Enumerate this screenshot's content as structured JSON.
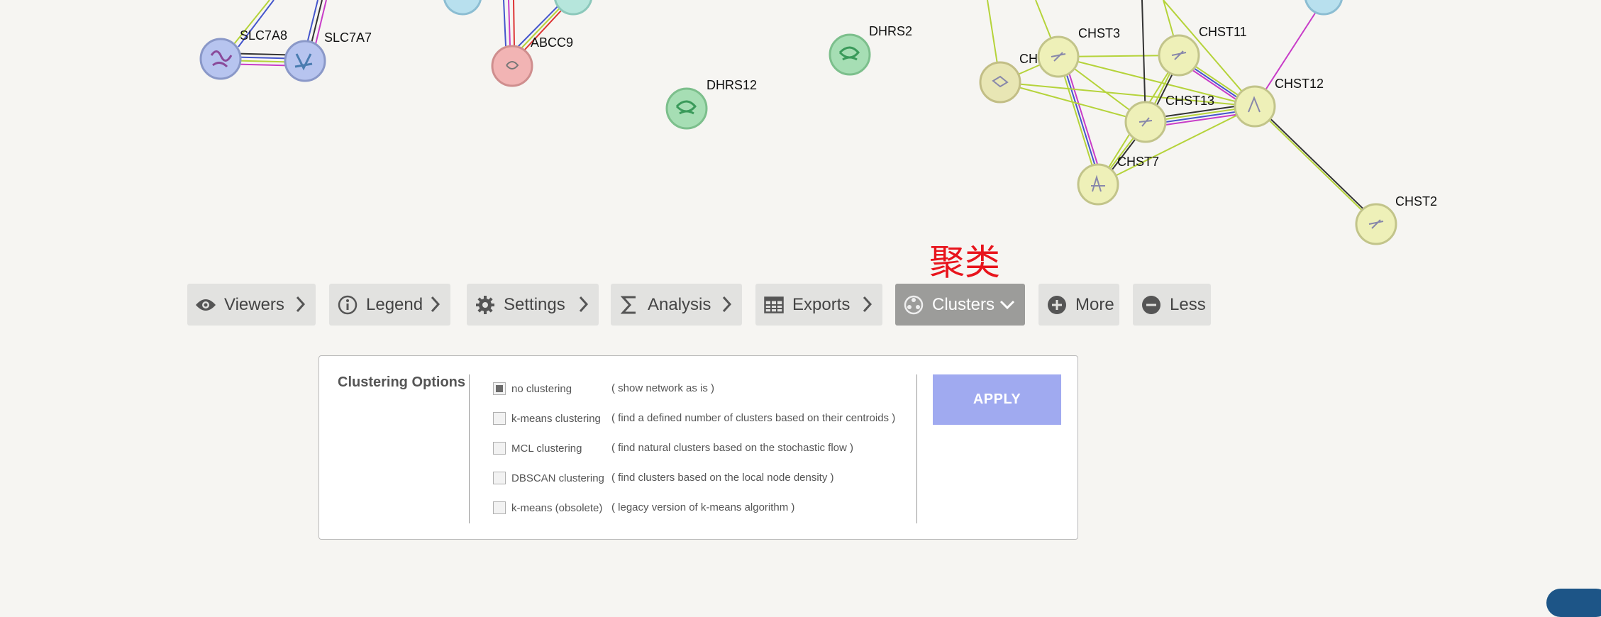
{
  "annotation": "聚类",
  "network": {
    "nodes": [
      {
        "label": "SLC7A8"
      },
      {
        "label": "SLC7A7"
      },
      {
        "label": "ABCC9"
      },
      {
        "label": "DHRS12"
      },
      {
        "label": "DHRS2"
      },
      {
        "label": "CH"
      },
      {
        "label": "CHST3"
      },
      {
        "label": "CHST11"
      },
      {
        "label": "CHST12"
      },
      {
        "label": "CHST13"
      },
      {
        "label": "CHST7"
      },
      {
        "label": "CHST2"
      }
    ],
    "colors": {
      "blue_node": "#b7c4ef",
      "red_node": "#f2b4b4",
      "green_node": "#a6deb4",
      "yellow_node": "#eef0b8",
      "edge_black": "#333333",
      "edge_yellowgreen": "#b5d33a",
      "edge_blue": "#4455cc",
      "edge_magenta": "#c83cc8"
    }
  },
  "toolbar": {
    "buttons": [
      {
        "label": "Viewers",
        "icon": "eye-icon"
      },
      {
        "label": "Legend",
        "icon": "info-icon"
      },
      {
        "label": "Settings",
        "icon": "gear-icon"
      },
      {
        "label": "Analysis",
        "icon": "sigma-icon"
      },
      {
        "label": "Exports",
        "icon": "table-icon"
      },
      {
        "label": "Clusters",
        "icon": "clusters-icon",
        "active": true
      },
      {
        "label": "More",
        "icon": "plus-circle-icon"
      },
      {
        "label": "Less",
        "icon": "minus-circle-icon"
      }
    ]
  },
  "clustering": {
    "title": "Clustering Options",
    "options": [
      {
        "label": "no clustering",
        "desc": "( show network as is )",
        "checked": true
      },
      {
        "label": "k-means clustering",
        "desc": "( find a defined number of clusters based on their centroids )",
        "checked": false
      },
      {
        "label": "MCL clustering",
        "desc": "( find natural clusters based on the stochastic flow )",
        "checked": false
      },
      {
        "label": "DBSCAN clustering",
        "desc": "( find clusters based on the local node density )",
        "checked": false
      },
      {
        "label": "k-means (obsolete)",
        "desc": "( legacy version of k-means algorithm )",
        "checked": false
      }
    ],
    "apply_label": "APPLY"
  }
}
